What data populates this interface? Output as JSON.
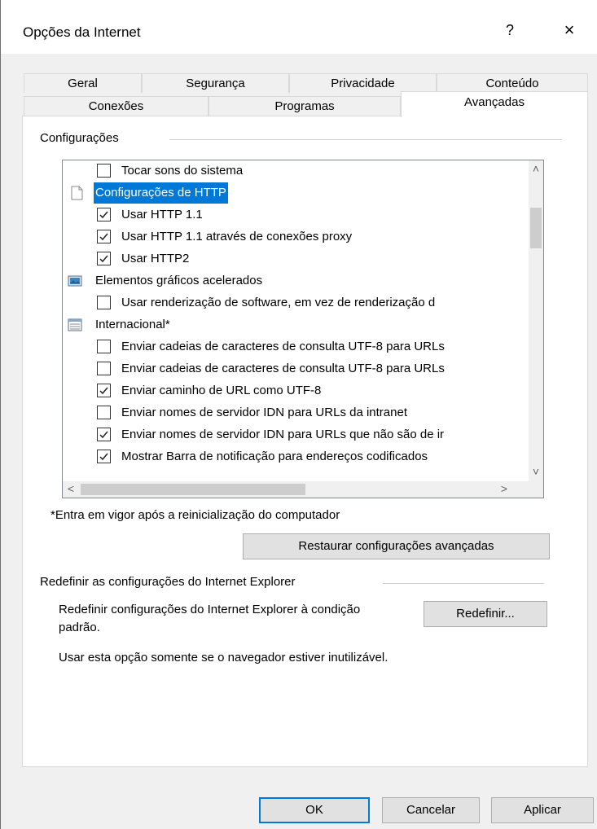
{
  "window": {
    "title": "Opções da Internet",
    "help": "?",
    "close": "×"
  },
  "tabs_row1": [
    "Geral",
    "Segurança",
    "Privacidade",
    "Conteúdo"
  ],
  "tabs_row2": [
    "Conexões",
    "Programas",
    "Avançadas"
  ],
  "active_tab": "Avançadas",
  "settings": {
    "group_label": "Configurações",
    "items": [
      {
        "type": "checkbox",
        "checked": false,
        "label": "Tocar sons do sistema"
      },
      {
        "type": "category",
        "icon": "page-icon",
        "label": "Configurações de HTTP",
        "selected": true
      },
      {
        "type": "checkbox",
        "checked": true,
        "label": "Usar HTTP 1.1"
      },
      {
        "type": "checkbox",
        "checked": true,
        "label": "Usar HTTP 1.1 através de conexões proxy"
      },
      {
        "type": "checkbox",
        "checked": true,
        "label": "Usar HTTP2"
      },
      {
        "type": "category",
        "icon": "monitor-icon",
        "label": "Elementos gráficos acelerados"
      },
      {
        "type": "checkbox",
        "checked": false,
        "label": "Usar renderização de software, em vez de renderização d"
      },
      {
        "type": "category",
        "icon": "list-icon",
        "label": "Internacional*"
      },
      {
        "type": "checkbox",
        "checked": false,
        "label": "Enviar cadeias de caracteres de consulta UTF-8 para URLs"
      },
      {
        "type": "checkbox",
        "checked": false,
        "label": "Enviar cadeias de caracteres de consulta UTF-8 para URLs"
      },
      {
        "type": "checkbox",
        "checked": true,
        "label": "Enviar caminho de URL como UTF-8"
      },
      {
        "type": "checkbox",
        "checked": false,
        "label": "Enviar nomes de servidor IDN para URLs da intranet"
      },
      {
        "type": "checkbox",
        "checked": true,
        "label": "Enviar nomes de servidor IDN para URLs que não são de ir"
      },
      {
        "type": "checkbox",
        "checked": true,
        "label": "Mostrar Barra de notificação para endereços codificados"
      }
    ],
    "restart_note": "*Entra em vigor após a reinicialização do computador",
    "restore_button": "Restaurar configurações avançadas"
  },
  "reset": {
    "group_label": "Redefinir as configurações do Internet Explorer",
    "description": "Redefinir configurações do Internet Explorer à condição padrão.",
    "button": "Redefinir...",
    "warning": "Usar esta opção somente se o navegador estiver inutilizável."
  },
  "footer": {
    "ok": "OK",
    "cancel": "Cancelar",
    "apply": "Aplicar"
  },
  "colors": {
    "accent": "#0078d7",
    "dialog_bg": "#f0f0f0",
    "panel_bg": "#ffffff"
  }
}
